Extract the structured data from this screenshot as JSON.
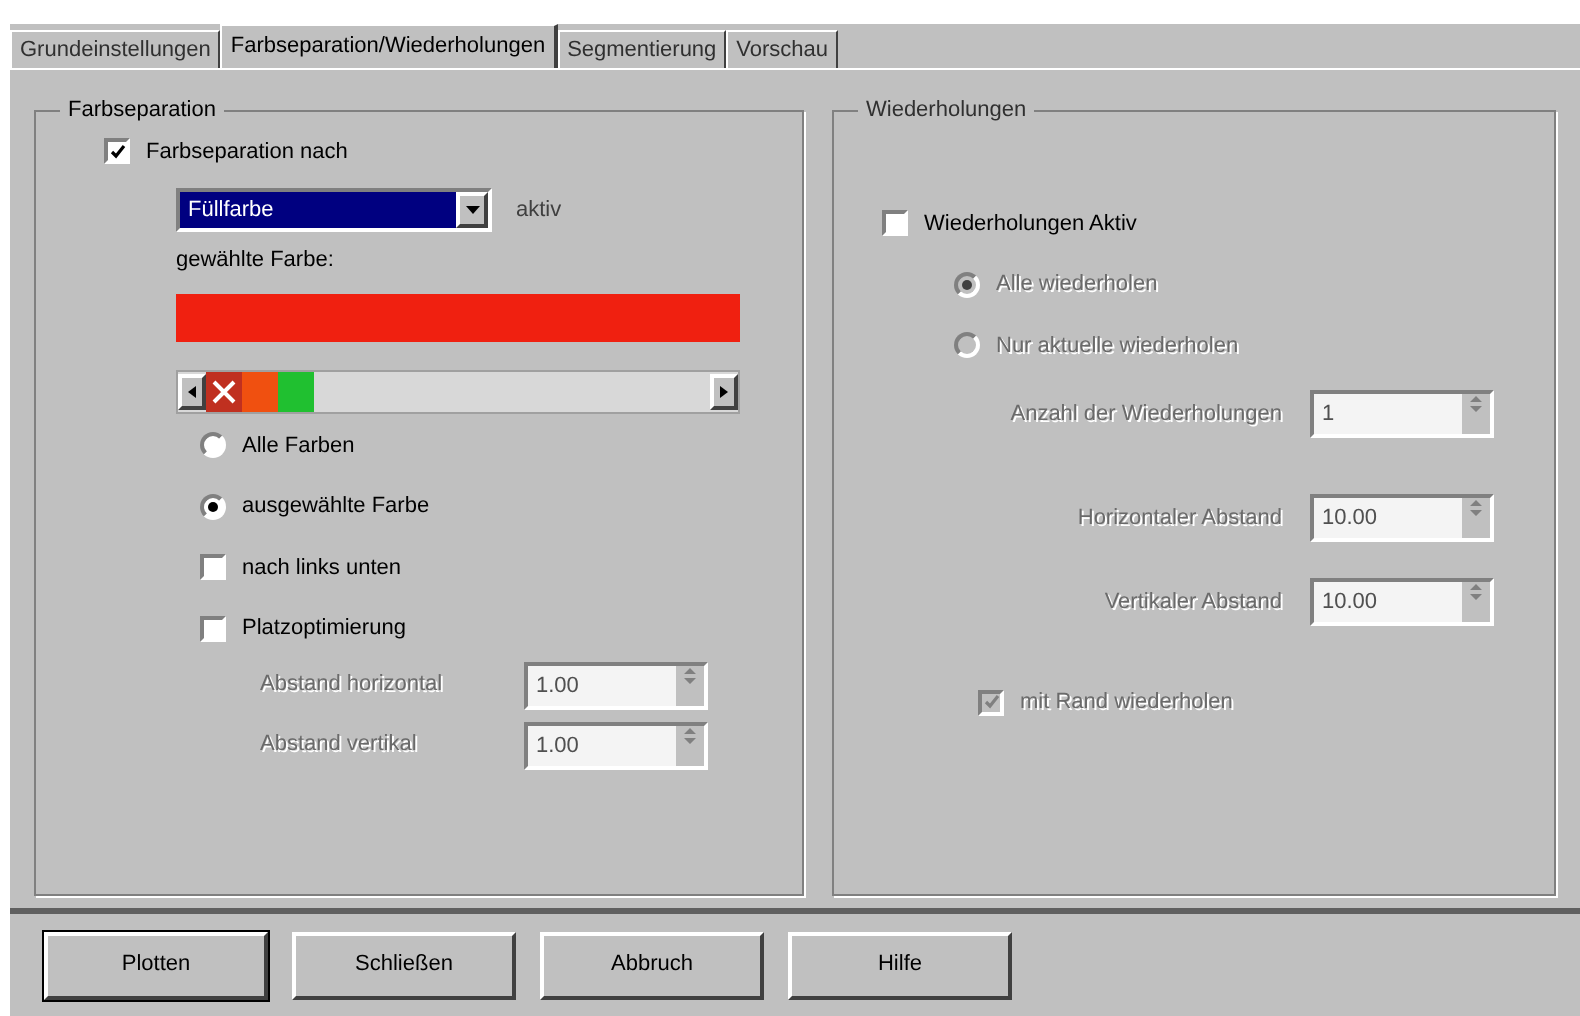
{
  "tabs": [
    {
      "label": "Grundeinstellungen",
      "selected": false
    },
    {
      "label": "Farbseparation/Wiederholungen",
      "selected": true
    },
    {
      "label": "Segmentierung",
      "selected": false
    },
    {
      "label": "Vorschau",
      "selected": false
    }
  ],
  "separation": {
    "title": "Farbseparation",
    "checkbox": {
      "label": "Farbseparation nach",
      "checked": true
    },
    "dropdown": {
      "value": "Füllfarbe"
    },
    "dropdown_note": "aktiv",
    "selected_color_label": "gewählte Farbe:",
    "swatches": [
      {
        "kind": "none",
        "color": "#c03020"
      },
      {
        "kind": "color",
        "color": "#f05010"
      },
      {
        "kind": "color",
        "color": "#20c030"
      }
    ],
    "options": [
      {
        "kind": "radio",
        "label": "Alle Farben",
        "checked": false
      },
      {
        "kind": "radio",
        "label": "ausgewählte Farbe",
        "checked": true
      },
      {
        "kind": "checkbox",
        "label": "nach links unten",
        "checked": false
      },
      {
        "kind": "checkbox",
        "label": "Platzoptimierung",
        "checked": false
      }
    ],
    "fields": [
      {
        "label": "Abstand horizontal",
        "value": "1.00",
        "disabled": true
      },
      {
        "label": "Abstand vertikal",
        "value": "1.00",
        "disabled": true
      }
    ]
  },
  "repeats": {
    "title": "Wiederholungen",
    "checkbox": {
      "label": "Wiederholungen Aktiv",
      "checked": false
    },
    "radios": [
      {
        "label": "Alle wiederholen",
        "selected": true,
        "disabled": true
      },
      {
        "label": "Nur aktuelle wiederholen",
        "selected": false,
        "disabled": true
      }
    ],
    "fields": [
      {
        "label": "Anzahl der Wiederholungen",
        "value": "1",
        "disabled": true
      },
      {
        "label": "Horizontaler Abstand",
        "value": "10.00",
        "disabled": true
      },
      {
        "label": "Vertikaler Abstand",
        "value": "10.00",
        "disabled": true
      }
    ],
    "bottom_checkbox": {
      "label": "mit Rand wiederholen",
      "checked": true,
      "disabled": true
    }
  },
  "buttons": [
    "Plotten",
    "Schließen",
    "Abbruch",
    "Hilfe"
  ]
}
